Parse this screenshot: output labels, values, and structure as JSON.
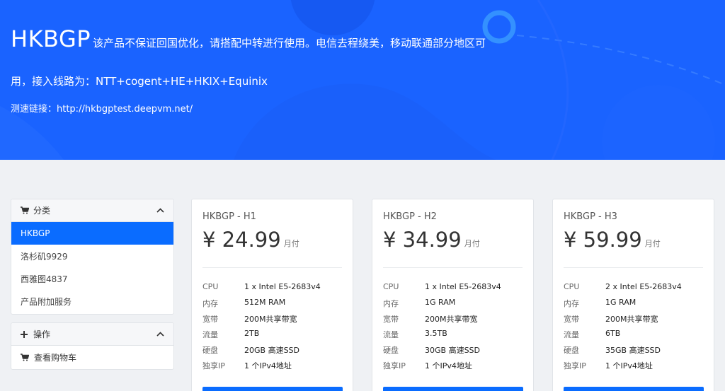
{
  "hero": {
    "title": "HKBGP",
    "description_line1": "该产品不保证回国优化，请搭配中转进行使用。电信去程绕美，移动联通部分地区可",
    "description_line2": "用，接入线路为：NTT+cogent+HE+HKIX+Equinix",
    "speedtest": "测速链接：http://hkbgptest.deepvm.net/"
  },
  "colors": {
    "accent": "#0a6cff",
    "hero_bg": "#1a63ff",
    "page_bg": "#eff1f4"
  },
  "categories": {
    "header": "分类",
    "header_icon": "cart-icon",
    "items": [
      {
        "label": "HKBGP",
        "active": true
      },
      {
        "label": "洛杉矶9929",
        "active": false
      },
      {
        "label": "西雅图4837",
        "active": false
      },
      {
        "label": "产品附加服务",
        "active": false
      }
    ]
  },
  "actions": {
    "header": "操作",
    "header_icon": "plus-icon",
    "items": [
      {
        "label": "查看购物车",
        "icon": "cart-icon"
      }
    ]
  },
  "products": [
    {
      "name": "HKBGP - H1",
      "price": "¥ 24.99",
      "period": "月付",
      "specs": [
        {
          "key": "CPU",
          "value": "1 x Intel E5-2683v4"
        },
        {
          "key": "内存",
          "value": "512M RAM"
        },
        {
          "key": "宽带",
          "value": "200M共享带宽"
        },
        {
          "key": "流量",
          "value": "2TB"
        },
        {
          "key": "硬盘",
          "value": "20GB 高速SSD"
        },
        {
          "key": "独享IP",
          "value": "1 个IPv4地址"
        }
      ]
    },
    {
      "name": "HKBGP - H2",
      "price": "¥ 34.99",
      "period": "月付",
      "specs": [
        {
          "key": "CPU",
          "value": "1 x Intel E5-2683v4"
        },
        {
          "key": "内存",
          "value": "1G RAM"
        },
        {
          "key": "宽带",
          "value": "200M共享带宽"
        },
        {
          "key": "流量",
          "value": "3.5TB"
        },
        {
          "key": "硬盘",
          "value": "30GB 高速SSD"
        },
        {
          "key": "独享IP",
          "value": "1 个IPv4地址"
        }
      ]
    },
    {
      "name": "HKBGP - H3",
      "price": "¥ 59.99",
      "period": "月付",
      "specs": [
        {
          "key": "CPU",
          "value": "2 x Intel E5-2683v4"
        },
        {
          "key": "内存",
          "value": "1G RAM"
        },
        {
          "key": "宽带",
          "value": "200M共享带宽"
        },
        {
          "key": "流量",
          "value": "6TB"
        },
        {
          "key": "硬盘",
          "value": "35GB 高速SSD"
        },
        {
          "key": "独享IP",
          "value": "1 个IPv4地址"
        }
      ]
    }
  ]
}
